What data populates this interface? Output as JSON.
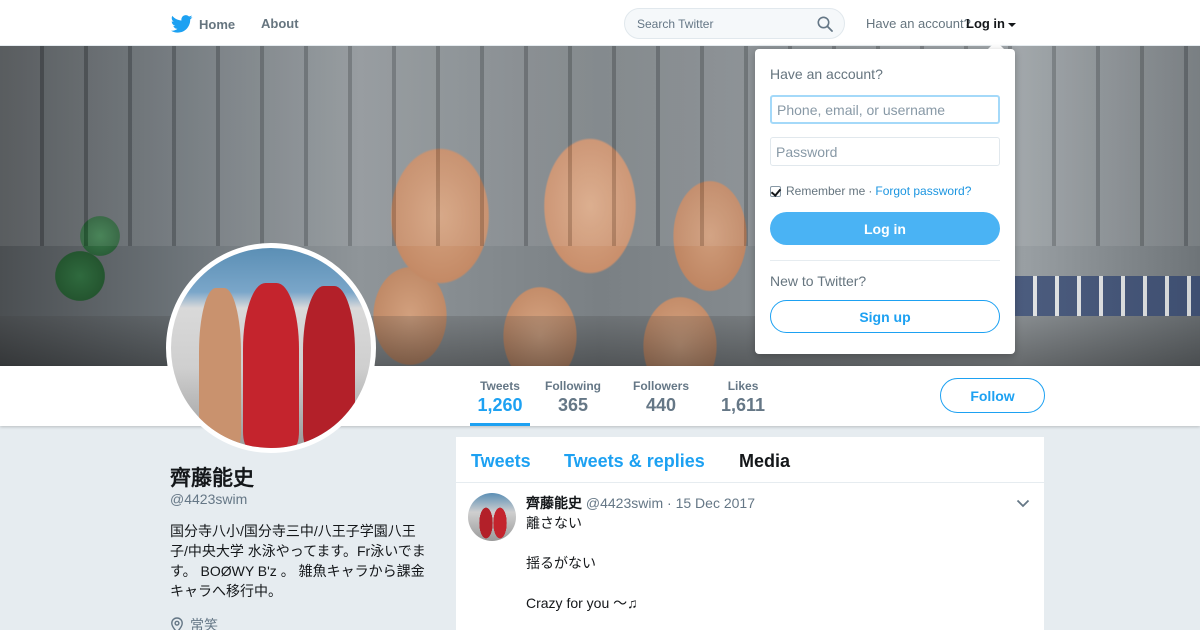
{
  "nav": {
    "home_label": "Home",
    "about_label": "About",
    "search_placeholder": "Search Twitter",
    "have_account": "Have an account?",
    "login_label": "Log in"
  },
  "profile": {
    "name": "齊藤能史",
    "handle": "@4423swim",
    "bio": "国分寺八小/国分寺三中/八王子学園八王子/中央大学 水泳やってます。Fr泳いでます。 BOØWY B'z 。 雑魚キャラから課金キャラへ移行中。",
    "location": "常笑"
  },
  "stats": [
    {
      "label": "Tweets",
      "value": "1,260"
    },
    {
      "label": "Following",
      "value": "365"
    },
    {
      "label": "Followers",
      "value": "440"
    },
    {
      "label": "Likes",
      "value": "1,611"
    }
  ],
  "follow_label": "Follow",
  "tabs": [
    {
      "label": "Tweets"
    },
    {
      "label": "Tweets & replies"
    },
    {
      "label": "Media"
    }
  ],
  "tweet": {
    "name": "齊藤能史",
    "handle": "@4423swim",
    "date": "· 15 Dec 2017",
    "lines": [
      "離さない",
      "揺るがない",
      "Crazy for you 〜♫"
    ]
  },
  "login_dropdown": {
    "title": "Have an account?",
    "username_placeholder": "Phone, email, or username",
    "password_placeholder": "Password",
    "remember_label": "Remember me",
    "separator": "·",
    "forgot_label": "Forgot password?",
    "login_button": "Log in",
    "new_label": "New to Twitter?",
    "signup_button": "Sign up"
  },
  "colors": {
    "accent": "#1da1f2",
    "login_button_bg": "#4ab3f4",
    "page_bg": "#e6ecf0"
  }
}
